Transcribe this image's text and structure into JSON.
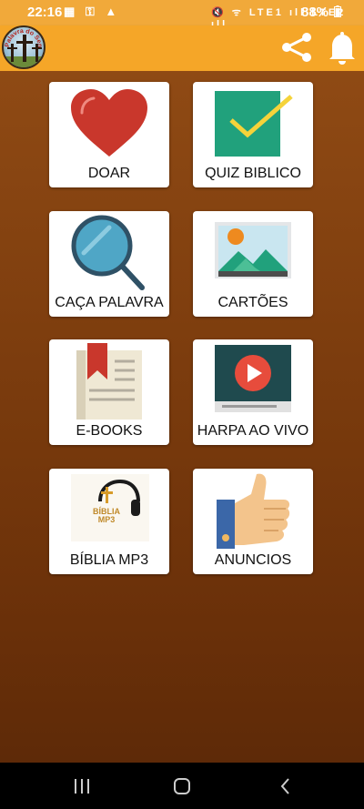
{
  "status_bar": {
    "time": "22:16",
    "left_icons": "▦ ⚿ ▲",
    "right_icons": "🔇 ᯤ LTE1 ıll LTE2 ıll",
    "battery": "88%"
  },
  "app_bar": {
    "logo_text": "Palavra do Senhor",
    "share_icon": "share-icon",
    "bell_icon": "bell-icon"
  },
  "menu": {
    "items": [
      {
        "label": "DOAR",
        "icon": "heart-icon"
      },
      {
        "label": "QUIZ BIBLICO",
        "icon": "checkmark-icon"
      },
      {
        "label": "CAÇA PALAVRA",
        "icon": "magnifier-icon"
      },
      {
        "label": "CARTÕES",
        "icon": "landscape-icon"
      },
      {
        "label": "E-BOOKS",
        "icon": "book-icon"
      },
      {
        "label": "HARPA AO VIVO",
        "icon": "video-icon"
      },
      {
        "label": "BÍBLIA MP3",
        "icon": "headphones-icon",
        "icon_text": "BÍBLIA MP3"
      },
      {
        "label": "ANUNCIOS",
        "icon": "thumbs-up-icon"
      }
    ]
  },
  "nav_bar": {
    "recent_icon": "recent-apps-icon",
    "home_icon": "home-icon",
    "back_icon": "back-icon"
  },
  "colors": {
    "app_bar": "#f5a628",
    "background": "#7d3d0e",
    "heart": "#c9372c",
    "quiz": "#21a17c",
    "accent_red": "#e74c3c"
  }
}
